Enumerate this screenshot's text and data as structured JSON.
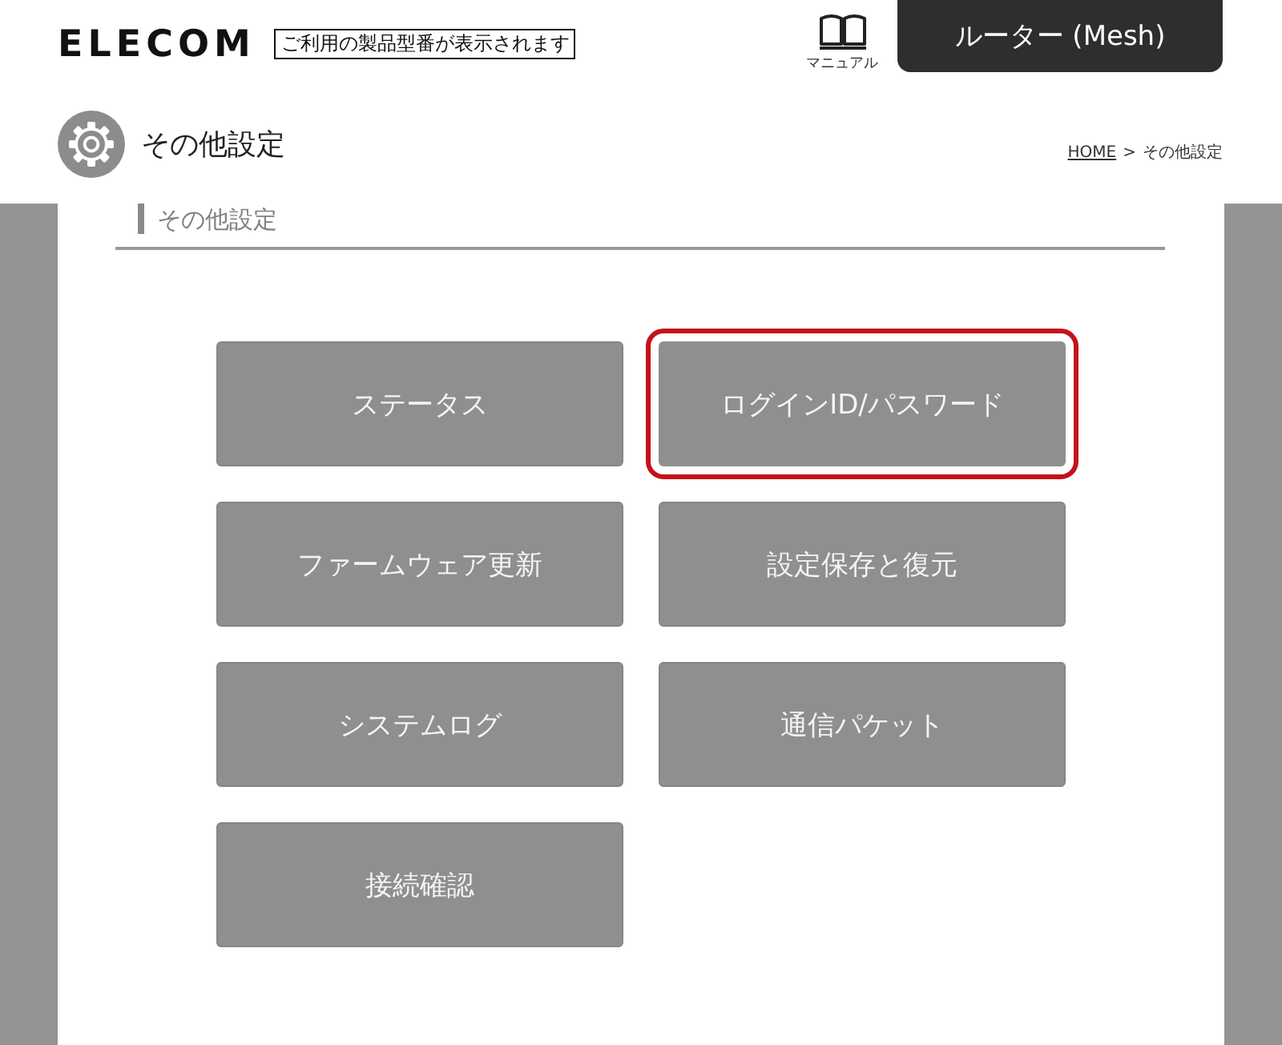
{
  "header": {
    "logo": "ELECOM",
    "model_label": "ご利用の製品型番が表示されます",
    "manual": {
      "label": "マニュアル"
    },
    "device_tab": {
      "label": "ルーター (Mesh)"
    }
  },
  "page_title": "その他設定",
  "breadcrumb": [
    {
      "label": "HOME",
      "kind": "link"
    },
    {
      "label": ">",
      "kind": "separator"
    },
    {
      "label": "その他設定",
      "kind": "current"
    }
  ],
  "section_title": "その他設定",
  "menu": [
    {
      "label": "ステータス",
      "selected": false
    },
    {
      "label": "ログインID/パスワード",
      "selected": true
    },
    {
      "label": "ファームウェア更新",
      "selected": false
    },
    {
      "label": "設定保存と復元",
      "selected": false
    },
    {
      "label": "システムログ",
      "selected": false
    },
    {
      "label": "通信パケット",
      "selected": false
    },
    {
      "label": "接続確認",
      "selected": false
    }
  ]
}
